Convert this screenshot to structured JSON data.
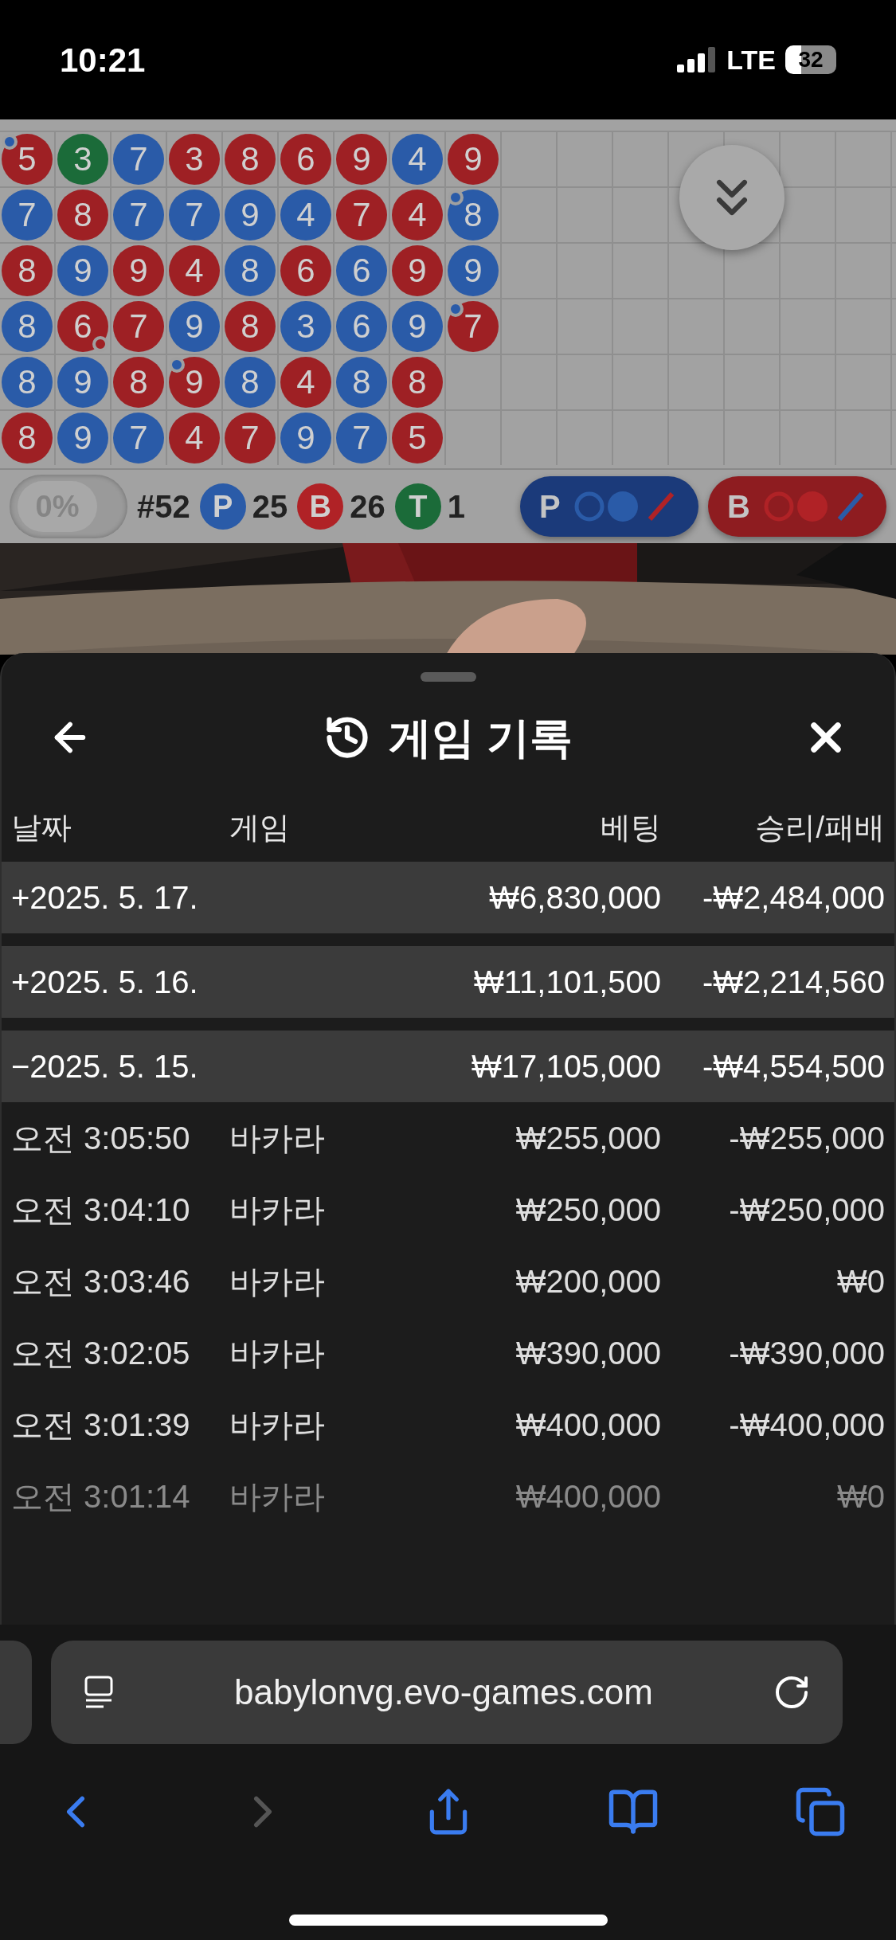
{
  "status_bar": {
    "time": "10:21",
    "network": "LTE",
    "battery": "32"
  },
  "bead_road": {
    "rows": [
      [
        {
          "value": "5",
          "color": "#9e2024",
          "pair_dot": {
            "kind": "player",
            "color": "#2a5ba8"
          }
        },
        {
          "value": "3",
          "color": "#1b6b39"
        },
        {
          "value": "7",
          "color": "#2a5ba8"
        },
        {
          "value": "3",
          "color": "#9e2024"
        },
        {
          "value": "8",
          "color": "#9e2024"
        },
        {
          "value": "6",
          "color": "#9e2024"
        },
        {
          "value": "9",
          "color": "#9e2024"
        },
        {
          "value": "4",
          "color": "#2a5ba8"
        },
        {
          "value": "9",
          "color": "#9e2024"
        }
      ],
      [
        {
          "value": "7",
          "color": "#2a5ba8"
        },
        {
          "value": "8",
          "color": "#9e2024"
        },
        {
          "value": "7",
          "color": "#2a5ba8"
        },
        {
          "value": "7",
          "color": "#2a5ba8"
        },
        {
          "value": "9",
          "color": "#2a5ba8"
        },
        {
          "value": "4",
          "color": "#2a5ba8"
        },
        {
          "value": "7",
          "color": "#9e2024"
        },
        {
          "value": "4",
          "color": "#9e2024"
        },
        {
          "value": "8",
          "color": "#2a5ba8",
          "pair_dot": {
            "kind": "player",
            "color": "#2a5ba8"
          }
        }
      ],
      [
        {
          "value": "8",
          "color": "#9e2024"
        },
        {
          "value": "9",
          "color": "#2a5ba8"
        },
        {
          "value": "9",
          "color": "#9e2024"
        },
        {
          "value": "4",
          "color": "#9e2024"
        },
        {
          "value": "8",
          "color": "#2a5ba8"
        },
        {
          "value": "6",
          "color": "#9e2024"
        },
        {
          "value": "6",
          "color": "#2a5ba8"
        },
        {
          "value": "9",
          "color": "#9e2024"
        },
        {
          "value": "9",
          "color": "#2a5ba8"
        }
      ],
      [
        {
          "value": "8",
          "color": "#2a5ba8"
        },
        {
          "value": "6",
          "color": "#9e2024",
          "pair_dot": {
            "kind": "banker",
            "color": "#9e2024"
          }
        },
        {
          "value": "7",
          "color": "#9e2024"
        },
        {
          "value": "9",
          "color": "#2a5ba8"
        },
        {
          "value": "8",
          "color": "#9e2024"
        },
        {
          "value": "3",
          "color": "#2a5ba8"
        },
        {
          "value": "6",
          "color": "#2a5ba8"
        },
        {
          "value": "9",
          "color": "#2a5ba8"
        },
        {
          "value": "7",
          "color": "#9e2024",
          "pair_dot": {
            "kind": "player",
            "color": "#2a5ba8"
          }
        }
      ],
      [
        {
          "value": "8",
          "color": "#2a5ba8"
        },
        {
          "value": "9",
          "color": "#2a5ba8"
        },
        {
          "value": "8",
          "color": "#9e2024"
        },
        {
          "value": "9",
          "color": "#9e2024",
          "pair_dot": {
            "kind": "player",
            "color": "#2a5ba8"
          }
        },
        {
          "value": "8",
          "color": "#2a5ba8"
        },
        {
          "value": "4",
          "color": "#9e2024"
        },
        {
          "value": "8",
          "color": "#2a5ba8"
        },
        {
          "value": "8",
          "color": "#9e2024"
        }
      ],
      [
        {
          "value": "8",
          "color": "#9e2024"
        },
        {
          "value": "9",
          "color": "#2a5ba8"
        },
        {
          "value": "7",
          "color": "#2a5ba8"
        },
        {
          "value": "4",
          "color": "#9e2024"
        },
        {
          "value": "7",
          "color": "#9e2024"
        },
        {
          "value": "9",
          "color": "#2a5ba8"
        },
        {
          "value": "7",
          "color": "#2a5ba8"
        },
        {
          "value": "5",
          "color": "#9e2024"
        }
      ]
    ]
  },
  "stats_bar": {
    "percent": "0%",
    "round": "#52",
    "counts": [
      {
        "letter": "P",
        "count": "25",
        "color": "#2a5ba8"
      },
      {
        "letter": "B",
        "count": "26",
        "color": "#b02226"
      },
      {
        "letter": "T",
        "count": "1",
        "color": "#1b6b39"
      }
    ],
    "predict_buttons": [
      {
        "letter": "P",
        "kind": "player",
        "color": "#1b3a7a"
      },
      {
        "letter": "B",
        "kind": "banker",
        "color": "#8e1c20"
      }
    ]
  },
  "history": {
    "title": "게임 기록",
    "columns": [
      "날짜",
      "게임",
      "베팅",
      "승리/패배"
    ],
    "days": [
      {
        "sign": "+",
        "date": "2025. 5. 17.",
        "bet": "₩6,830,000",
        "result": "-₩2,484,000"
      },
      {
        "sign": "+",
        "date": "2025. 5. 16.",
        "bet": "₩11,101,500",
        "result": "-₩2,214,560"
      },
      {
        "sign": "−",
        "date": "2025. 5. 15.",
        "bet": "₩17,105,000",
        "result": "-₩4,554,500",
        "rows": [
          {
            "time": "오전 3:05:50",
            "game": "바카라",
            "bet": "₩255,000",
            "result": "-₩255,000"
          },
          {
            "time": "오전 3:04:10",
            "game": "바카라",
            "bet": "₩250,000",
            "result": "-₩250,000"
          },
          {
            "time": "오전 3:03:46",
            "game": "바카라",
            "bet": "₩200,000",
            "result": "₩0"
          },
          {
            "time": "오전 3:02:05",
            "game": "바카라",
            "bet": "₩390,000",
            "result": "-₩390,000"
          },
          {
            "time": "오전 3:01:39",
            "game": "바카라",
            "bet": "₩400,000",
            "result": "-₩400,000"
          },
          {
            "time": "오전 3:01:14",
            "game": "바카라",
            "bet": "₩400,000",
            "result": "₩0"
          }
        ]
      }
    ]
  },
  "browser": {
    "url": "babylonvg.evo-games.com"
  }
}
